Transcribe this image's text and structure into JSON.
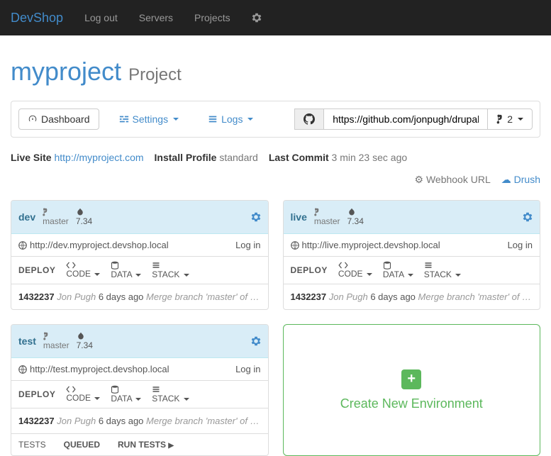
{
  "nav": {
    "brand": "DevShop",
    "links": [
      "Log out",
      "Servers",
      "Projects"
    ]
  },
  "project": {
    "name": "myproject",
    "subtitle": "Project"
  },
  "toolbar": {
    "dashboard": "Dashboard",
    "settings": "Settings",
    "logs": "Logs",
    "repo_url": "https://github.com/jonpugh/drupal.g",
    "branch_btn": "2"
  },
  "meta": {
    "live_label": "Live Site",
    "live_url": "http://myproject.com",
    "profile_label": "Install Profile",
    "profile_value": "standard",
    "commit_label": "Last Commit",
    "commit_time": "3 min 23 sec ago",
    "webhook": "Webhook URL",
    "drush": "Drush"
  },
  "actions": {
    "deploy": "DEPLOY",
    "code": "CODE",
    "data": "DATA",
    "stack": "STACK",
    "login": "Log in",
    "tests": "TESTS",
    "queued": "QUEUED",
    "run_tests": "RUN TESTS"
  },
  "envs": [
    {
      "name": "dev",
      "branch": "master",
      "version": "7.34",
      "url": "http://dev.myproject.devshop.local",
      "commit_sha": "1432237",
      "commit_author": "Jon Pugh",
      "commit_age": "6 days ago",
      "commit_msg": "Merge branch 'master' of …",
      "has_tests": false
    },
    {
      "name": "live",
      "branch": "master",
      "version": "7.34",
      "url": "http://live.myproject.devshop.local",
      "commit_sha": "1432237",
      "commit_author": "Jon Pugh",
      "commit_age": "6 days ago",
      "commit_msg": "Merge branch 'master' of …",
      "has_tests": false
    },
    {
      "name": "test",
      "branch": "master",
      "version": "7.34",
      "url": "http://test.myproject.devshop.local",
      "commit_sha": "1432237",
      "commit_author": "Jon Pugh",
      "commit_age": "6 days ago",
      "commit_msg": "Merge branch 'master' of …",
      "has_tests": true
    }
  ],
  "create_env": "Create New Environment"
}
